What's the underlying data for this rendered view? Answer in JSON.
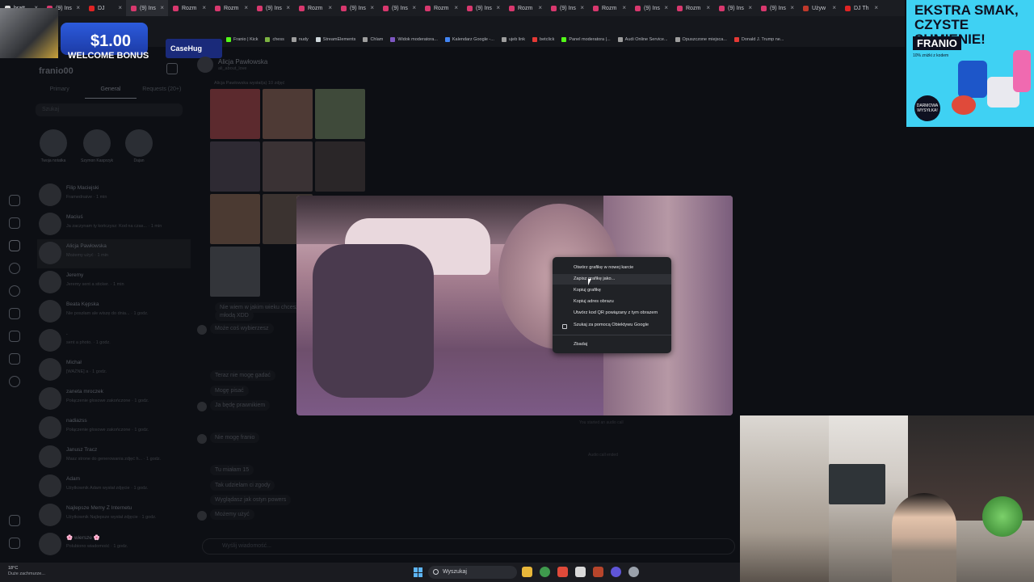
{
  "browser": {
    "tabs": [
      {
        "label": "bratt"
      },
      {
        "label": "(9) Ins"
      },
      {
        "label": "DJ"
      },
      {
        "label": "(9) Ins"
      },
      {
        "label": "Rozm"
      },
      {
        "label": "Rozm"
      },
      {
        "label": "(9) Ins"
      },
      {
        "label": "Rozm"
      },
      {
        "label": "(9) Ins"
      },
      {
        "label": "(9) Ins"
      },
      {
        "label": "Rozm"
      },
      {
        "label": "(9) Ins"
      },
      {
        "label": "Rozm"
      },
      {
        "label": "(9) Ins"
      },
      {
        "label": "Rozm"
      },
      {
        "label": "(9) Ins"
      },
      {
        "label": "Rozm"
      },
      {
        "label": "(9) Ins"
      },
      {
        "label": "(9) Ins"
      },
      {
        "label": "Używ"
      },
      {
        "label": "DJ Th"
      }
    ],
    "bookmarks": [
      "Franio | Kick",
      "chess",
      "nudy",
      "StreamElements",
      "Chlam",
      "Widok moderatora...",
      "Kalendarz Google -...",
      "ujeb link",
      "betclick",
      "Panel moderatora |...",
      "Audi Online Service...",
      "Opuszczone miejsca...",
      "Donald J. Trump ne..."
    ]
  },
  "promo_banner": {
    "amount": "$1.00",
    "text": "WELCOME BONUS",
    "brand": "CaseHug"
  },
  "ad": {
    "line1": "EKSTRA SMAK,",
    "line2": "CZYSTE SUMIENIE!",
    "brand": "FRANIO",
    "sub": "10% zniżki z kodem",
    "badge": "DARMOWA WYSYŁKA!"
  },
  "inbox": {
    "username": "franio00",
    "tabs": [
      "Primary",
      "General",
      "Requests (20+)"
    ],
    "search_placeholder": "Szukaj",
    "stories": [
      {
        "note": "Zacznij festiwal ...",
        "name": "Twoja notatka"
      },
      {
        "note": "Wesoły przegrzani z ziemniakami",
        "name": "Szymon Kasprzyk"
      },
      {
        "note": "Maskib... Schemat",
        "name": "Dajan"
      }
    ],
    "threads": [
      {
        "name": "Filip Maciejski",
        "preview": "Framednaive · 1 min"
      },
      {
        "name": "Maciuś",
        "preview": "Ja zaczynam ty kończysz: Kod na czas... · 1 min"
      },
      {
        "name": "Alicja Pawłowska",
        "preview": "Możemy użyć · 1 min"
      },
      {
        "name": "Jeremy",
        "preview": "Jeremy sent a sticker. · 1 min"
      },
      {
        "name": "Beata Kępska",
        "preview": "Nie poszłam ale wiszę do dnia... · 1 godz."
      },
      {
        "name": ".",
        "preview": "sent a photo. · 1 godz."
      },
      {
        "name": "Michał",
        "preview": "[WAŻNE] a · 1 godz."
      },
      {
        "name": "zaneta mroczek",
        "preview": "Połączenie głosowe zakończone · 1 godz."
      },
      {
        "name": "nadiazss",
        "preview": "Połączenie głosowe zakończone · 1 godz."
      },
      {
        "name": "Janusz Tracz",
        "preview": "Masz strone do generowania zdjęć h... · 1 godz."
      },
      {
        "name": "Adam",
        "preview": "Użytkownik Adam wysłał zdjęcie · 1 godz."
      },
      {
        "name": "Najlepsze Memy Z Internetu",
        "preview": "Użytkownik Najlepsze wysłał zdjęcie · 1 godz."
      },
      {
        "name": "🌸 wiersze 🌸",
        "preview": "Polubiono wiadomość · 1 godz."
      }
    ]
  },
  "chat": {
    "name": "Alicja Pawłowska",
    "handle": "ali_about_love",
    "sent_info": "Alicja Pawłowska wysłał(a) 10 zdjęć",
    "messages": [
      "Nie wiem w jakim wieku chcesz mieć",
      "młodą XDD",
      "Może coś wybierzesz",
      "Teraz nie mogę gadać",
      "Mogę pisać",
      "Ja będę prawnikiem",
      "Nie mogę franio",
      "Tu miałam 15",
      "Tak udzielam ci zgody",
      "Wyglądasz jak ostyn powers",
      "Możemy użyć"
    ],
    "system": [
      "You started an audio call",
      "Audio call ended"
    ],
    "composer_placeholder": "Wyślij wiadomość..."
  },
  "context_menu": {
    "items": [
      "Otwórz grafikę w nowej karcie",
      "Zapisz grafikę jako...",
      "Kopiuj grafikę",
      "Kopiuj adres obrazu",
      "Utwórz kod QR powiązany z tym obrazem",
      "Szukaj za pomocą Obiektywu Google",
      "Zbadaj"
    ]
  },
  "taskbar": {
    "temp": "18°C",
    "weather": "Duże zachmurze...",
    "search_label": "Wyszukaj"
  },
  "colors": {
    "accent": "#d8386e",
    "menu_bg": "#202226",
    "taskbar": "#1a1b20"
  }
}
